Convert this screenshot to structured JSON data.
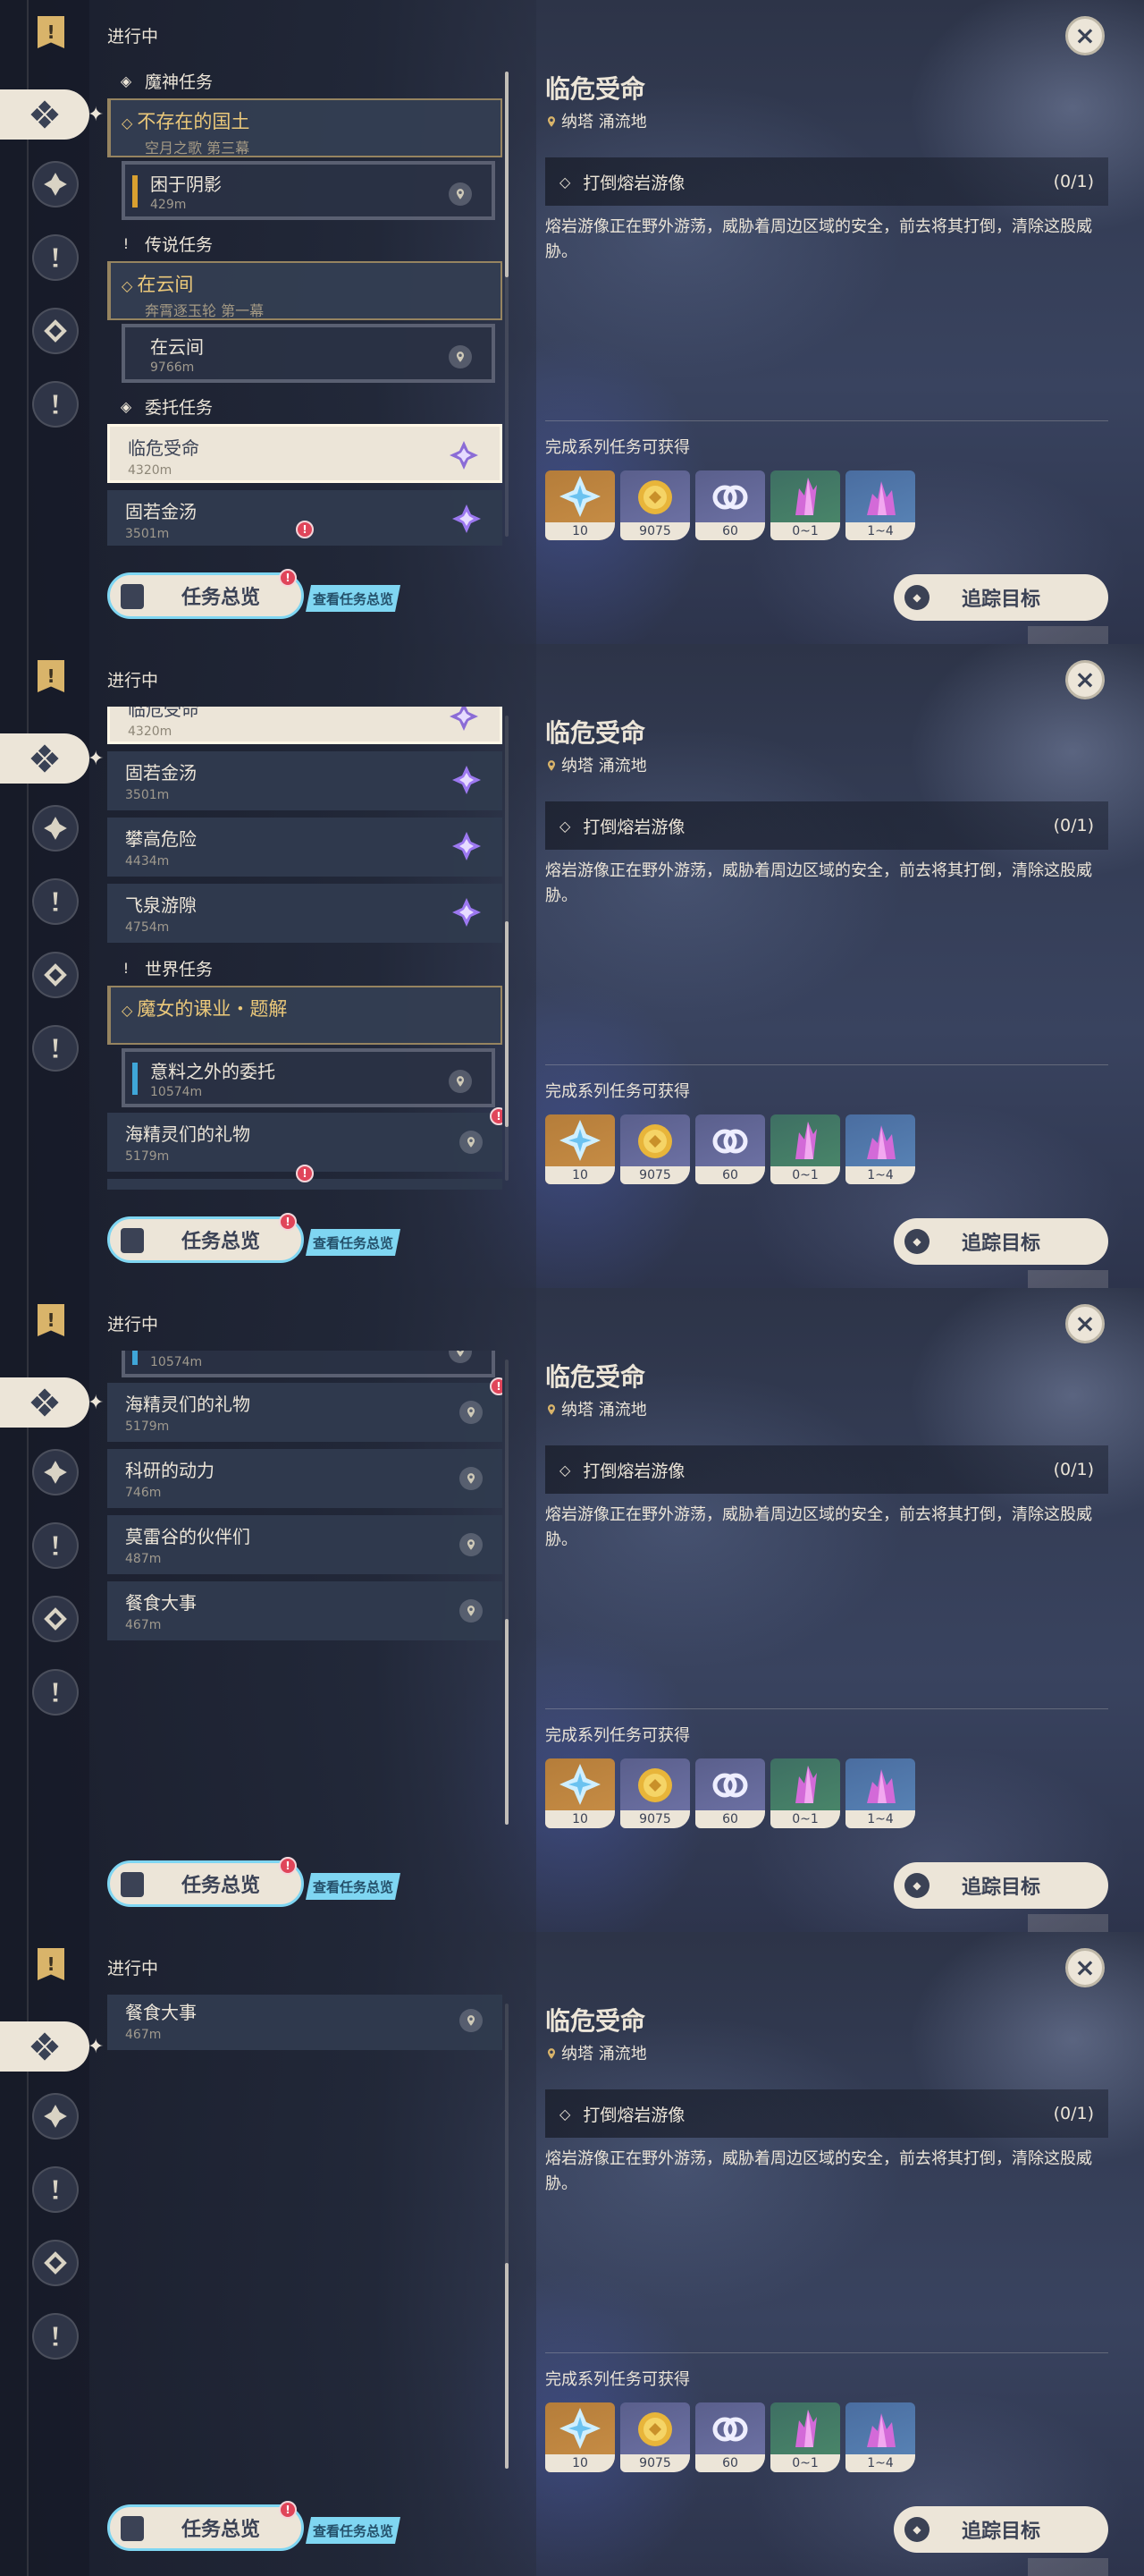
{
  "header": {
    "status": "进行中",
    "close_icon": "close-icon"
  },
  "sections": {
    "archon": "魔神任务",
    "legend": "传说任务",
    "commission": "委托任务",
    "world": "世界任务"
  },
  "quests": {
    "archon_chain": {
      "title": "不存在的国土",
      "subtitle": "空月之歌 第三幕"
    },
    "archon_sub": {
      "title": "困于阴影",
      "distance": "429m"
    },
    "legend_chain": {
      "title": "在云间",
      "subtitle": "奔霄逐玉轮 第一幕"
    },
    "legend_sub": {
      "title": "在云间",
      "distance": "9766m"
    },
    "commissions": [
      {
        "title": "临危受命",
        "distance": "4320m"
      },
      {
        "title": "固若金汤",
        "distance": "3501m"
      },
      {
        "title": "攀高危险",
        "distance": "4434m"
      },
      {
        "title": "飞泉游隙",
        "distance": "4754m"
      }
    ],
    "world_chain": {
      "title": "魔女的课业・题解"
    },
    "world_sub": {
      "title": "意料之外的委托",
      "distance": "10574m"
    },
    "world_items": [
      {
        "title": "海精灵们的礼物",
        "distance": "5179m"
      },
      {
        "title": "科研的动力",
        "distance": "746m"
      },
      {
        "title": "莫雷谷的伙伴们",
        "distance": "487m"
      },
      {
        "title": "餐食大事",
        "distance": "467m"
      }
    ]
  },
  "detail": {
    "title": "临危受命",
    "location": "纳塔 涌流地",
    "objective": "打倒熔岩游像",
    "progress": "(0/1)",
    "description": "熔岩游像正在野外游荡，威胁着周边区域的安全，前去将其打倒，清除这股威胁。",
    "rewards_label": "完成系列任务可获得",
    "rewards": [
      {
        "icon": "primogem-icon",
        "count": "10"
      },
      {
        "icon": "mora-icon",
        "count": "9075"
      },
      {
        "icon": "friendship-icon",
        "count": "60"
      },
      {
        "icon": "crystal-green-icon",
        "count": "0~1"
      },
      {
        "icon": "crystal-pink-icon",
        "count": "1~4"
      }
    ]
  },
  "footer": {
    "overview": "任务总览",
    "view_overview": "查看任务总览",
    "track": "追踪目标"
  },
  "badge": "!",
  "colors": {
    "accent": "#ece5d8",
    "gold": "#d9b46a",
    "cyan": "#7fd6f2",
    "alert": "#e0455a"
  }
}
